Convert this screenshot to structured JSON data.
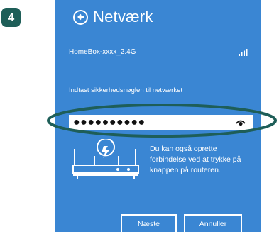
{
  "step_badge": "4",
  "header": {
    "title": "Netværk"
  },
  "network": {
    "name": "HomeBox-xxxx_2.4G"
  },
  "security": {
    "prompt": "Indtast sikkerhedsnøglen til netværket",
    "password_mask": "●●●●●●●●●●"
  },
  "wps_hint": "Du kan også oprette forbindelse ved at trykke på knappen på routeren.",
  "buttons": {
    "next": "Næste",
    "cancel": "Annuller"
  },
  "colors": {
    "panel": "#3a86d3",
    "accent": "#1e5e58"
  },
  "icons": {
    "back": "back-arrow-icon",
    "signal": "wifi-signal-icon",
    "eye": "eye-icon",
    "router": "router-icon"
  }
}
